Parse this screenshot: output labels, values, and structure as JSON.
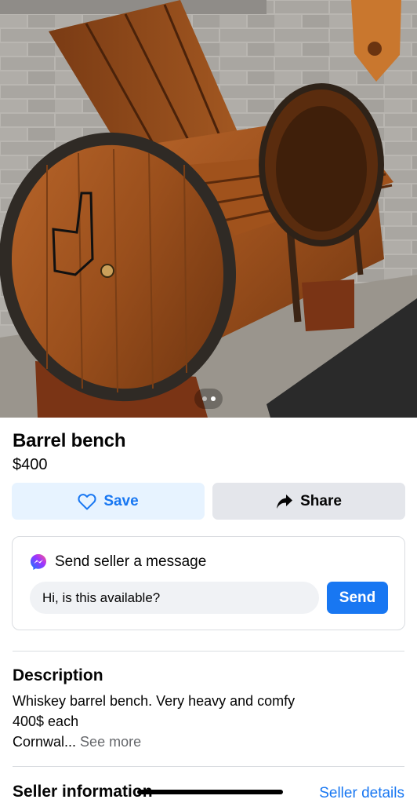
{
  "listing": {
    "title": "Barrel bench",
    "price": "$400"
  },
  "gallery": {
    "photo_count": 2,
    "active_index": 1
  },
  "actions": {
    "save_label": "Save",
    "share_label": "Share",
    "save_icon": "heart-outline-icon",
    "share_icon": "share-arrow-icon"
  },
  "message": {
    "heading": "Send seller a message",
    "input_value": "Hi, is this available?",
    "send_label": "Send",
    "icon": "messenger-icon"
  },
  "description": {
    "heading": "Description",
    "line1": "Whiskey barrel bench.  Very heavy and comfy",
    "line2": "400$ each",
    "line3": "Cornwal...",
    "see_more": "See more"
  },
  "seller": {
    "heading": "Seller information",
    "details_link": "Seller details"
  },
  "colors": {
    "accent": "#1877f2",
    "save_bg": "#e7f3ff",
    "share_bg": "#e4e6eb",
    "muted_text": "#65676b"
  }
}
